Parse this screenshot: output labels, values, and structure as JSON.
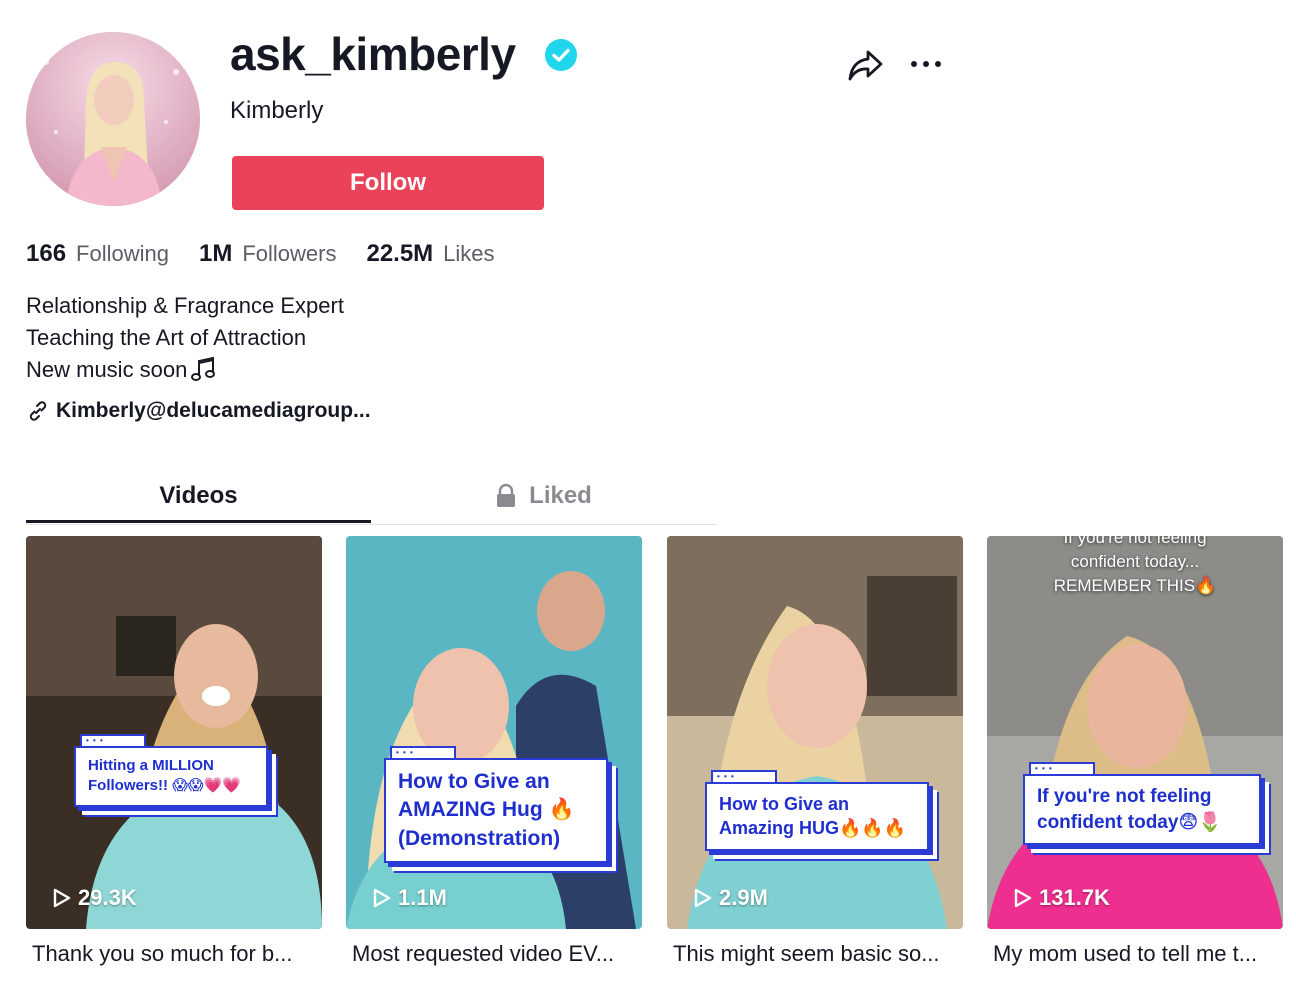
{
  "profile": {
    "username": "ask_kimberly",
    "display_name": "Kimberly",
    "verified": true,
    "follow_label": "Follow",
    "avatar_icon": "profile-photo"
  },
  "actions": {
    "share_icon": "share-arrow-icon",
    "more_icon": "more-dots-icon"
  },
  "stats": [
    {
      "value": "166",
      "label": "Following"
    },
    {
      "value": "1M",
      "label": "Followers"
    },
    {
      "value": "22.5M",
      "label": "Likes"
    }
  ],
  "bio": {
    "lines": [
      "Relationship & Fragrance Expert",
      "Teaching the Art of Attraction",
      "New music soon"
    ],
    "link": "Kimberly@delucamediagroup..."
  },
  "tabs": {
    "videos": "Videos",
    "liked": "Liked"
  },
  "videos": [
    {
      "views": "29.3K",
      "overlay_lines": [
        "Hitting a MILLION",
        "Followers!! 😱😱💗💗"
      ],
      "description": "Thank you so much for b..."
    },
    {
      "views": "1.1M",
      "overlay_lines": [
        "How to Give an",
        "AMAZING Hug 🔥",
        "(Demonstration)"
      ],
      "description": "Most requested video EV..."
    },
    {
      "views": "2.9M",
      "overlay_lines": [
        "How to Give an",
        "Amazing HUG🔥🔥🔥"
      ],
      "description": "This might seem basic so..."
    },
    {
      "views": "131.7K",
      "top_text": [
        "If you're not feeling",
        "confident today...",
        "REMEMBER THIS🔥"
      ],
      "overlay_lines": [
        "If you're not feeling",
        "confident today😨🌷"
      ],
      "description": "My mom used to tell me t..."
    }
  ],
  "colors": {
    "follow": "#ea4359",
    "verified": "#20d5ec",
    "caption_blue": "#2b3bd6"
  }
}
